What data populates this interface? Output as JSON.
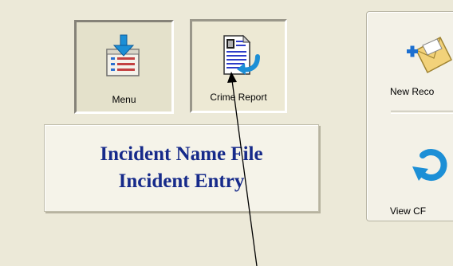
{
  "toolbar": {
    "menu_label": "Menu",
    "crime_report_label": "Crime Report"
  },
  "incident_panel": {
    "line1": "Incident Name File",
    "line2": "Incident Entry"
  },
  "right_panel": {
    "new_record_label": "New Reco",
    "view_cfs_label": "View CF"
  },
  "icons": {
    "menu": "menu-list-icon",
    "crime_report": "crime-report-document-icon",
    "new_record": "new-record-envelope-icon",
    "view_cfs": "refresh-arrow-icon"
  },
  "colors": {
    "window_background": "#ece9d8",
    "title_text": "#162a8a",
    "icon_blue": "#1c8fd6"
  }
}
